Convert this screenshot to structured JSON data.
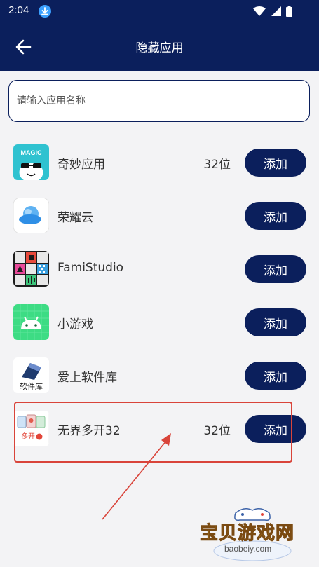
{
  "status_bar": {
    "time": "2:04"
  },
  "header": {
    "title": "隐藏应用"
  },
  "search": {
    "placeholder": "请输入应用名称"
  },
  "apps": [
    {
      "name": "奇妙应用",
      "count": "32位",
      "button": "添加",
      "icon": "magic-app-icon"
    },
    {
      "name": "荣耀云",
      "count": "",
      "button": "添加",
      "icon": "honor-cloud-icon"
    },
    {
      "name": "FamiStudio",
      "count": "",
      "button": "添加",
      "icon": "famistudio-icon"
    },
    {
      "name": "小游戏",
      "count": "",
      "button": "添加",
      "icon": "android-icon"
    },
    {
      "name": "爱上软件库",
      "count": "",
      "button": "添加",
      "icon": "software-library-icon"
    },
    {
      "name": "无界多开32",
      "count": "32位",
      "button": "添加",
      "icon": "multi-open-icon"
    }
  ],
  "icon_labels": {
    "magic": "MAGIC",
    "software": "软件库",
    "multi": "多开"
  },
  "watermark": {
    "text": "宝贝游戏网",
    "url": "baobeiy.com"
  },
  "colors": {
    "primary": "#0b1f5c",
    "highlight": "#d9443a",
    "background": "#f3f3f5"
  }
}
